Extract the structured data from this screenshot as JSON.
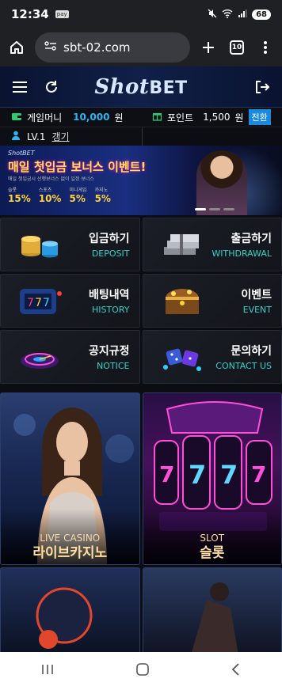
{
  "status": {
    "time": "12:34",
    "pay": "pay",
    "battery": "68"
  },
  "browser": {
    "url": "sbt-02.com",
    "tab_count": "10"
  },
  "site": {
    "logo_main": "Shot",
    "logo_accent": "BET"
  },
  "account": {
    "money_label": "게임머니",
    "money_value": "10,000",
    "money_unit": "원",
    "points_label": "포인트",
    "points_value": "1,500",
    "points_unit": "원",
    "convert_label": "전환",
    "level": "LV.1",
    "name": "갱기"
  },
  "banner": {
    "logo": "ShotBET",
    "title": "매일 첫입금 보너스 이벤트!",
    "subtitle": "매일 첫입금시 선행보너스 없이 일정 보너스",
    "stats": [
      {
        "label": "슬롯",
        "value": "15%"
      },
      {
        "label": "스포츠",
        "value": "10%"
      },
      {
        "label": "미니게임",
        "value": "5%"
      },
      {
        "label": "카지노",
        "value": "5%"
      }
    ]
  },
  "menu": [
    {
      "ko": "입금하기",
      "en": "DEPOSIT"
    },
    {
      "ko": "출금하기",
      "en": "WITHDRAWAL"
    },
    {
      "ko": "배팅내역",
      "en": "HISTORY"
    },
    {
      "ko": "이벤트",
      "en": "EVENT"
    },
    {
      "ko": "공지규정",
      "en": "NOTICE"
    },
    {
      "ko": "문의하기",
      "en": "CONTACT US"
    }
  ],
  "games": [
    {
      "en": "LIVE CASINO",
      "ko": "라이브카지노"
    },
    {
      "en": "SLOT",
      "ko": "슬롯"
    }
  ],
  "colors": {
    "accent": "#29b6f6",
    "teal": "#35d0c8",
    "gold": "#ffe0a0"
  }
}
